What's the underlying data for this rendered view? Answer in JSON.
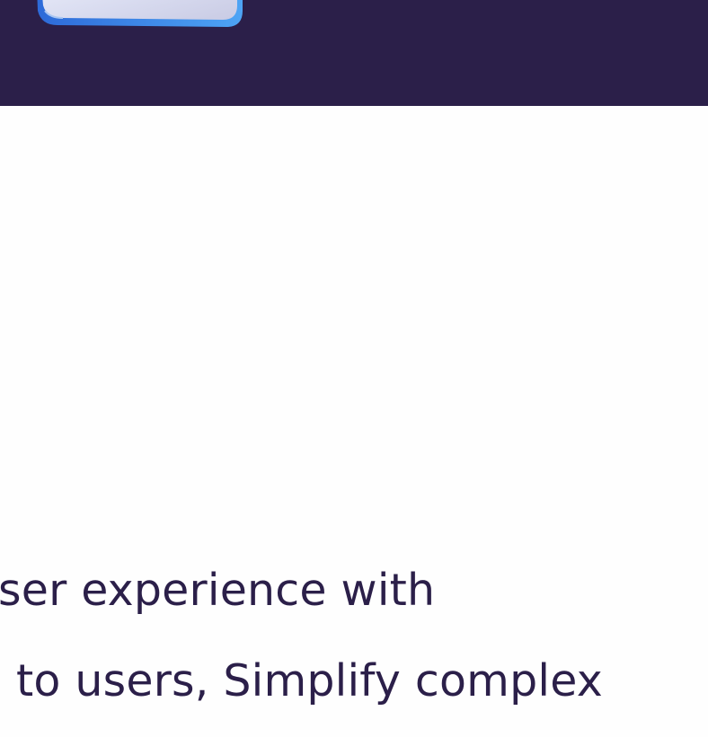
{
  "hero": {
    "background_color": "#2b1f49",
    "graphic_icon": "device-screen-icon"
  },
  "content": {
    "lines": [
      "ser experience with",
      "to users, Simplify complex"
    ],
    "text_color": "#2b1f49"
  }
}
